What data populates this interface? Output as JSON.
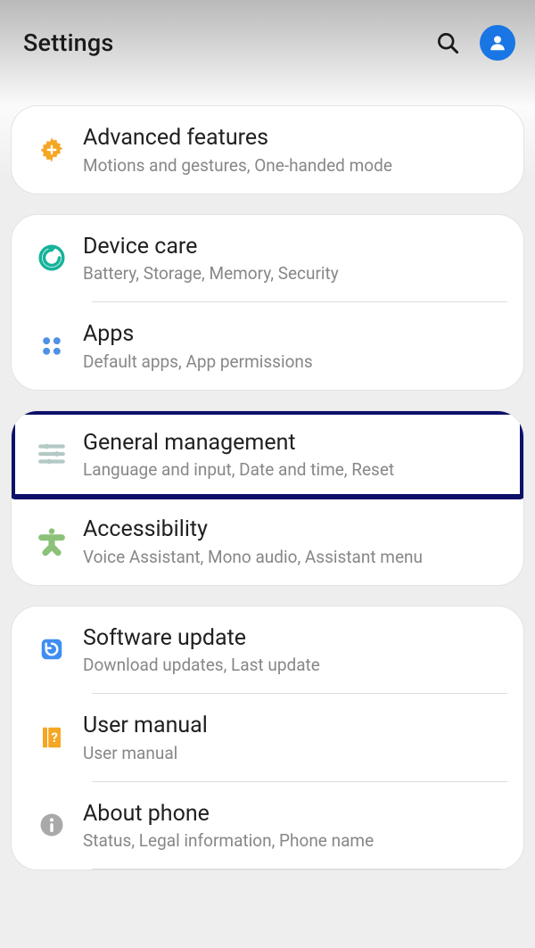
{
  "header": {
    "title": "Settings"
  },
  "groups": [
    {
      "items": [
        {
          "key": "advanced-features",
          "title": "Advanced features",
          "subtitle": "Motions and gestures, One-handed mode",
          "icon": "gear-plus"
        }
      ]
    },
    {
      "items": [
        {
          "key": "device-care",
          "title": "Device care",
          "subtitle": "Battery, Storage, Memory, Security",
          "icon": "device-care"
        },
        {
          "key": "apps",
          "title": "Apps",
          "subtitle": "Default apps, App permissions",
          "icon": "apps"
        }
      ]
    },
    {
      "items": [
        {
          "key": "general-management",
          "title": "General management",
          "subtitle": "Language and input, Date and time, Reset",
          "icon": "sliders",
          "highlight": true
        },
        {
          "key": "accessibility",
          "title": "Accessibility",
          "subtitle": "Voice Assistant, Mono audio, Assistant menu",
          "icon": "accessibility"
        }
      ]
    },
    {
      "items": [
        {
          "key": "software-update",
          "title": "Software update",
          "subtitle": "Download updates, Last update",
          "icon": "software-update"
        },
        {
          "key": "user-manual",
          "title": "User manual",
          "subtitle": "User manual",
          "icon": "user-manual"
        },
        {
          "key": "about-phone",
          "title": "About phone",
          "subtitle": "Status, Legal information, Phone name",
          "icon": "info"
        }
      ]
    }
  ]
}
